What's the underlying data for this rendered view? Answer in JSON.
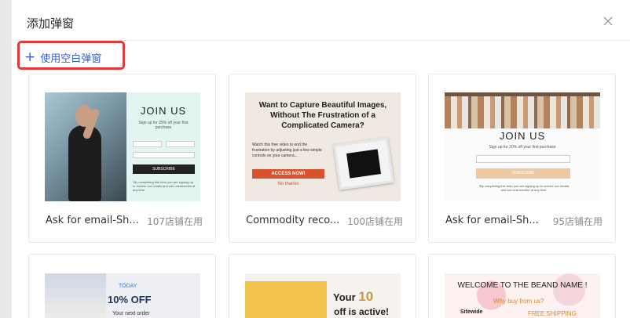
{
  "dialog": {
    "title": "添加弹窗",
    "close_icon": "close-icon",
    "blank_button": {
      "icon": "plus-icon",
      "label": "使用空白弹窗"
    },
    "highlight_color": "#e53935",
    "link_color": "#2f5fd8"
  },
  "templates": [
    {
      "name": "Ask for email-Sh...",
      "usage": "107店铺在用",
      "preview": {
        "heading": "JOIN US",
        "offer": "Sign up for 25% off your first purchase",
        "button": "SUBSCRIBE",
        "fine_print": "*By completing this form you are signing up to receive our emails and can unsubscribe at any time"
      }
    },
    {
      "name": "Commodity reco...",
      "usage": "100店铺在用",
      "preview": {
        "heading": "Want to Capture Beautiful Images, Without The Frustration of a Complicated Camera?",
        "description": "Watch this free video to end the frustration by adjusting just a few simple controls on your camera...",
        "button": "ACCESS NOW!",
        "secondary": "No thanks"
      }
    },
    {
      "name": "Ask for email-Sh...",
      "usage": "95店铺在用",
      "preview": {
        "heading": "JOIN US",
        "offer": "Sign up for 20% off your first purchase",
        "button": "SUBSCRIBE",
        "fine_print": "*By completing this form you are signing up to receive our emails and can unsubscribe at any time."
      }
    },
    {
      "preview": {
        "label": "TODAY",
        "heading": "10% OFF",
        "sub": "Your next order"
      }
    },
    {
      "preview": {
        "heading_a": "Your",
        "heading_num": "10",
        "sub": "off is active!"
      }
    },
    {
      "preview": {
        "heading": "WELCOME TO THE BEAND NAME !",
        "question": "Why buy from us?",
        "left": "Sitewide",
        "right": "FREE SHIPPING"
      }
    }
  ]
}
